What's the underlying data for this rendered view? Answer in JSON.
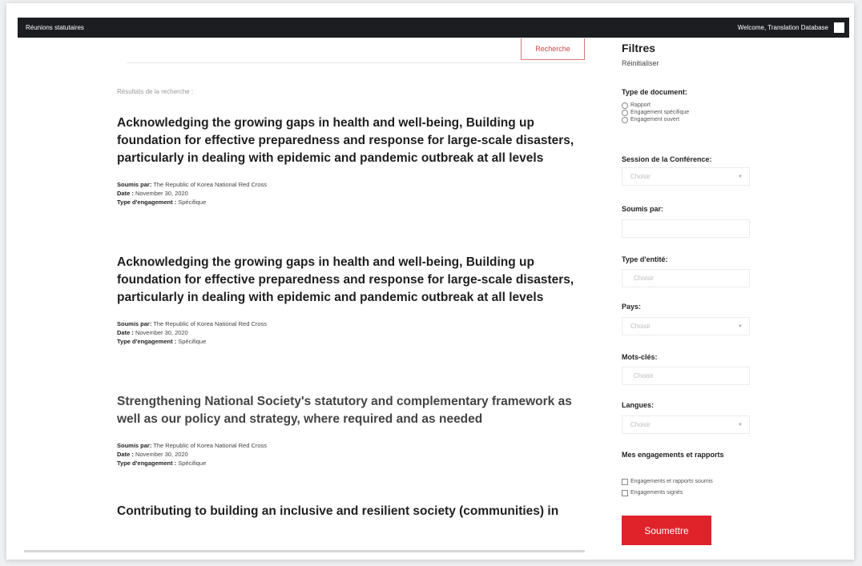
{
  "topbar": {
    "breadcrumb": "Réunions statutaires",
    "welcome": "Welcome, Translation Database"
  },
  "search": {
    "button_label": "Recherche",
    "results_label": "Résultats de la recherche :"
  },
  "meta_labels": {
    "submitted_by": "Soumis par:",
    "date": "Date :",
    "engagement_type": "Type d'engagement :"
  },
  "results": [
    {
      "title": "Acknowledging the growing gaps in health and well-being, Building up foundation for effective preparedness and response for large-scale disasters, particularly in dealing with epidemic and pandemic outbreak at all levels",
      "submitted_by": "The Republic of Korea National Red Cross",
      "date": "November 30, 2020",
      "engagement_type": "Spécifique"
    },
    {
      "title": "Acknowledging the growing gaps in health and well-being, Building up foundation for effective preparedness and response for large-scale disasters, particularly in dealing with epidemic and pandemic outbreak at all levels",
      "submitted_by": "The Republic of Korea National Red Cross",
      "date": "November 30, 2020",
      "engagement_type": "Spécifique"
    },
    {
      "title": "Strengthening National Society's statutory and complementary framework as well as our policy and strategy, where required and as needed",
      "submitted_by": "The Republic of Korea National Red Cross",
      "date": "November 30, 2020",
      "engagement_type": "Spécifique"
    },
    {
      "title": "Contributing to building an inclusive and resilient society (communities) in"
    }
  ],
  "filters": {
    "title": "Filtres",
    "reset": "Réinitialiser",
    "doc_type": {
      "label": "Type de document:",
      "options": [
        "Rapport",
        "Engagement spécifique",
        "Engagement ouvert"
      ]
    },
    "session": {
      "label": "Session de la Conférence:",
      "placeholder": "Choisir"
    },
    "submitted_by": {
      "label": "Soumis par:",
      "value": ""
    },
    "entity_type": {
      "label": "Type d'entité:",
      "placeholder": "Choisir"
    },
    "country": {
      "label": "Pays:",
      "placeholder": "Choisir"
    },
    "keywords": {
      "label": "Mots-clés:",
      "placeholder": "Choisir"
    },
    "languages": {
      "label": "Langues:",
      "placeholder": "Choisir"
    },
    "mine": {
      "label": "Mes engagements et rapports",
      "options": [
        "Engagements et rapports soumis",
        "Engagements signés"
      ]
    },
    "submit_label": "Soumettre"
  },
  "colors": {
    "topbar": "#1c1d21",
    "accent": "#e0222b",
    "search_border": "#d97676"
  }
}
